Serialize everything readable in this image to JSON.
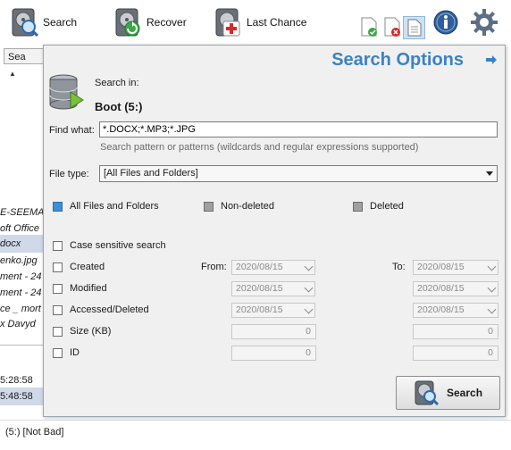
{
  "toolbar": {
    "search_label": "Search",
    "recover_label": "Recover",
    "last_chance_label": "Last Chance"
  },
  "background": {
    "tab_label": "Sea",
    "rows": [
      {
        "text": "E-SEEMA",
        "selected": false
      },
      {
        "text": "oft Office",
        "selected": false
      },
      {
        "text": "docx",
        "selected": true
      },
      {
        "text": "enko.jpg",
        "selected": false
      },
      {
        "text": "ment - 24",
        "selected": false
      },
      {
        "text": "ment - 24",
        "selected": false
      },
      {
        "text": "ce _ mort",
        "selected": false
      },
      {
        "text": "x Davyd",
        "selected": false
      }
    ],
    "time_rows": [
      {
        "text": "5:28:58",
        "selected": false
      },
      {
        "text": "5:48:58",
        "selected": true
      }
    ],
    "status_text": "(5:) [Not Bad]"
  },
  "panel": {
    "title": "Search Options",
    "search_in_label": "Search in:",
    "drive_name": "Boot (5:)",
    "find_what_label": "Find what:",
    "find_what_value": "*.DOCX;*.MP3;*.JPG",
    "find_hint": "Search pattern or patterns (wildcards and regular expressions supported)",
    "file_type_label": "File type:",
    "file_type_value": "[All Files and Folders]",
    "radios": {
      "all": "All Files and Folders",
      "non_deleted": "Non-deleted",
      "deleted": "Deleted"
    },
    "case_sensitive_label": "Case sensitive search",
    "created_label": "Created",
    "modified_label": "Modified",
    "accessed_label": "Accessed/Deleted",
    "size_label": "Size (KB)",
    "id_label": "ID",
    "from_label": "From:",
    "to_label": "To:",
    "dates": {
      "created_from": "2020/08/15",
      "created_to": "2020/08/15",
      "modified_from": "2020/08/15",
      "modified_to": "2020/08/15",
      "accessed_from": "2020/08/15",
      "accessed_to": "2020/08/15"
    },
    "size_from": "0",
    "size_to": "0",
    "id_from": "0",
    "id_to": "0",
    "search_button_label": "Search"
  },
  "colors": {
    "title_blue": "#3b82c4",
    "selected_row": "#cfd9e8",
    "radio_on": "#3c8fd8"
  }
}
